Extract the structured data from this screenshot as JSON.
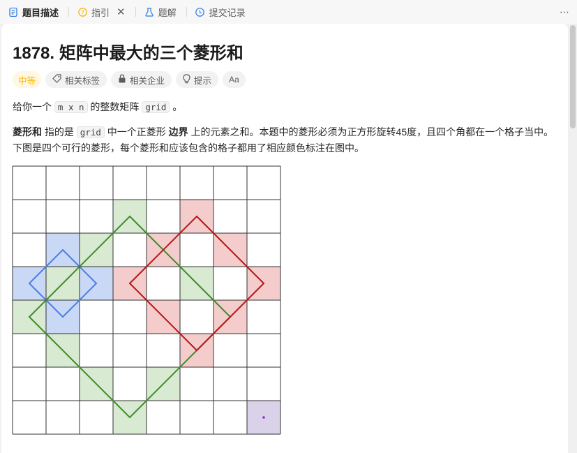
{
  "tabs": [
    {
      "label": "题目描述",
      "icon": "document-icon"
    },
    {
      "label": "指引",
      "icon": "question-circle-icon"
    },
    {
      "label": "题解",
      "icon": "flask-icon"
    },
    {
      "label": "提交记录",
      "icon": "clock-icon"
    }
  ],
  "more_icon": "⋯",
  "problem": {
    "title": "1878. 矩阵中最大的三个菱形和",
    "difficulty": "中等",
    "tags": [
      "相关标签",
      "相关企业",
      "提示",
      "Aa"
    ],
    "p1": {
      "a": "给你一个",
      "code1": "m x n",
      "b": "的整数矩阵",
      "code2": "grid",
      "c": "。"
    },
    "p2": {
      "bold1": "菱形和",
      "a": "指的是",
      "code": "grid",
      "b": "中一个正菱形",
      "bold2": "边界",
      "c": "上的元素之和。本题中的菱形必须为正方形旋转45度，且四个角都在一个格子当中。",
      "line2": "下图是四个可行的菱形，每个菱形和应该包含的格子都用了相应颜色标注在图中。"
    }
  },
  "colors": {
    "blue_fill": "#c9d8f5",
    "blue_line": "#4a7ee0",
    "green_fill": "#d6e9cf",
    "green_line": "#3f8a2a",
    "red_fill": "#f4cccc",
    "red_line": "#b01818",
    "purple_fill": "#d9d2e9",
    "purple_dot": "#8a2be2"
  }
}
